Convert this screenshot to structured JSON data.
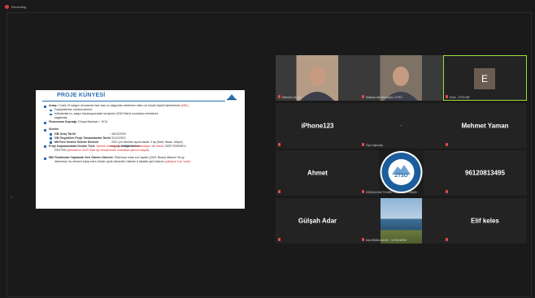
{
  "recording": {
    "label": "Recording",
    "color": "#e03a3a"
  },
  "slide": {
    "title": "PROJE KÜNYESİ",
    "rows": [
      {
        "style": "b",
        "parts": [
          {
            "t": "Amaç:",
            "bold": true
          },
          {
            "t": " Covid-19 salgını öncesinde faal olan ve salgından etkilenen mikro ve küçük ölçekli işletmelerin "
          },
          {
            "t": "(MKİ)",
            "red": true
          },
          {
            "t": ","
          }
        ]
      },
      {
        "style": "sb",
        "parts": [
          {
            "t": "Faaliyetlerinin sürdürmelerini,"
          }
        ]
      },
      {
        "style": "sb",
        "parts": [
          {
            "t": "İstihdamlarını, salgın başlangıcındaki seviyede (2020 Mart) muhafaza etmelerini,"
          }
        ]
      },
      {
        "style": "ind",
        "parts": [
          {
            "t": "sağlamak."
          }
        ]
      },
      {
        "style": "b",
        "parts": [
          {
            "t": "Finansman Kaynağı:",
            "bold": true
          },
          {
            "t": " Dünya Bankası + JICA"
          }
        ]
      },
      {
        "style": "gap"
      },
      {
        "style": "b",
        "parts": [
          {
            "t": "Süreler",
            "bold": true
          }
        ]
      },
      {
        "style": "sb",
        "parts": [
          {
            "t": "GB Onay Tarihi",
            "bold": true
          }
        ],
        "value": ": 18/12/2020"
      },
      {
        "style": "sb",
        "parts": [
          {
            "t": "GB Öngörülen Proje Tamamlanma Tarihi",
            "bold": true
          }
        ],
        "value": ": 31/12/2021"
      },
      {
        "style": "sb",
        "parts": [
          {
            "t": "MKİ'lere Destek Ödeme Dönemi",
            "bold": true
          }
        ],
        "value": ": 2021 yılı Haziran ayına kadar 3 ay (Mart, Nisan, Mayıs)"
      },
      {
        "style": "ind",
        "parts": [
          {
            "t": ""
          }
        ],
        "value": "karşılığı 3 taksit halinde"
      },
      {
        "style": "b",
        "parts": [
          {
            "t": "Proje Kapsamındaki Destek Türü:",
            "bold": true
          },
          {
            "t": " İşletme sermayesi",
            "red": true
          },
          {
            "t": " niteliğinde "
          },
          {
            "t": "harmanlayıcı",
            "red": true
          },
          {
            "t": " ve "
          },
          {
            "t": "faizsiz",
            "red": true
          },
          {
            "t": " GERİ ÖDEMELİ"
          }
        ]
      },
      {
        "style": "ind",
        "parts": [
          {
            "t": "DESTEK ("
          },
          {
            "t": "istihdamın 2020 Mart ayı seviyesinde muhafaza şartına dayalı",
            "red": true
          },
          {
            "t": ")"
          }
        ]
      },
      {
        "style": "gap"
      },
      {
        "style": "b",
        "parts": [
          {
            "t": "MKİ Tarafından Yapılacak Geri Ödeme Dönemi:",
            "bold": true
          },
          {
            "t": " Ödemeye esas son aydan (2021 Nisan) itibaren 36 ay"
          }
        ]
      },
      {
        "style": "ind",
        "parts": [
          {
            "t": "ödemesiz, bu dönemi takip eden dörder aylık dönemler halinde 6 taksitte geri ödeme "
          },
          {
            "t": "(yaklaşık 5 yıl vade)",
            "red": true
          }
        ]
      }
    ]
  },
  "tiles": [
    {
      "name": "",
      "label": "Mehmet Çengel",
      "kind": "camera",
      "bg": "#b59c86"
    },
    {
      "name": "",
      "label": "Sakarya Vali Yardımcısı / ZTSO",
      "kind": "camera",
      "bg": "#7d7265"
    },
    {
      "name": "",
      "label": "Emre - ZTSO ME",
      "kind": "avatar",
      "initial": "E",
      "active": true
    },
    {
      "name": "iPhone123",
      "label": "",
      "kind": "text"
    },
    {
      "name": "-",
      "label": "Oya Coşkunay",
      "kind": "text",
      "dim": true
    },
    {
      "name": "Mehmet Yaman",
      "label": "",
      "kind": "text"
    },
    {
      "name": "Ahmet",
      "label": "",
      "kind": "text"
    },
    {
      "name": "",
      "label": "ZONGULDAK TİCARET VE SANAYİ ODASI",
      "kind": "logo",
      "logo_text": "ZTSO"
    },
    {
      "name": "96120813495",
      "label": "",
      "kind": "text"
    },
    {
      "name": "Gülşah Adar",
      "label": "",
      "kind": "text"
    },
    {
      "name": "",
      "label": "KALKINMA AJANSI - YAPIM BİRİM",
      "kind": "camera-sea"
    },
    {
      "name": "Elif keles",
      "label": "",
      "kind": "text"
    }
  ]
}
